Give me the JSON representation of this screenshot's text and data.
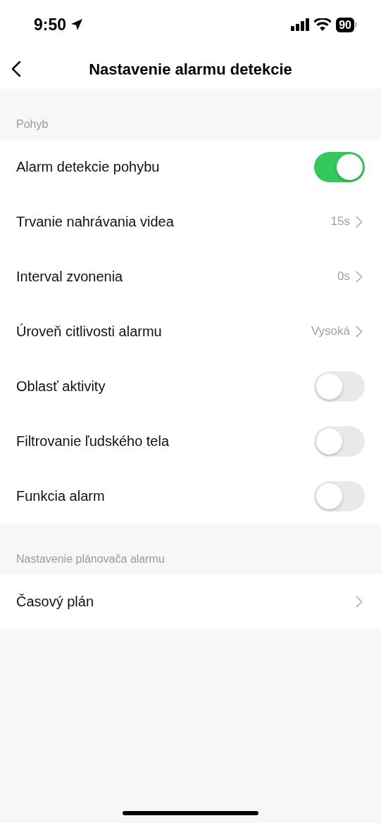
{
  "status_bar": {
    "time": "9:50",
    "battery": "90"
  },
  "header": {
    "title": "Nastavenie alarmu detekcie"
  },
  "sections": [
    {
      "label": "Pohyb",
      "rows": [
        {
          "kind": "toggle",
          "label": "Alarm detekcie pohybu",
          "on": true
        },
        {
          "kind": "link",
          "label": "Trvanie nahrávania videa",
          "value": "15s"
        },
        {
          "kind": "link",
          "label": "Interval zvonenia",
          "value": "0s"
        },
        {
          "kind": "link",
          "label": "Úroveň citlivosti alarmu",
          "value": "Vysoká"
        },
        {
          "kind": "toggle",
          "label": "Oblasť aktivity",
          "on": false
        },
        {
          "kind": "toggle",
          "label": "Filtrovanie ľudského tela",
          "on": false
        },
        {
          "kind": "toggle",
          "label": "Funkcia alarm",
          "on": false
        }
      ]
    },
    {
      "label": "Nastavenie plánovača alarmu",
      "rows": [
        {
          "kind": "link",
          "label": "Časový plán"
        }
      ]
    }
  ]
}
